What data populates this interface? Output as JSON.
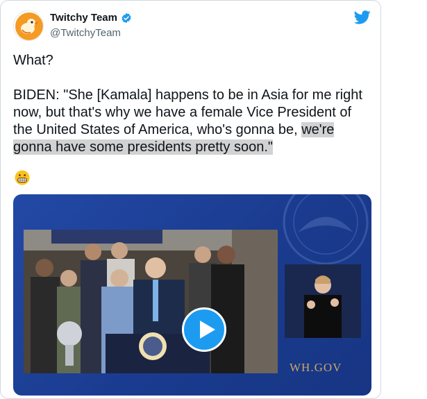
{
  "tweet": {
    "author_name": "Twitchy Team",
    "author_handle": "@TwitchyTeam",
    "text_line1": "What?",
    "text_quote_plain": "BIDEN: \"She [Kamala] happens to be in Asia for me right now, but that's why we have a female Vice President of the United States of America, who's gonna be, ",
    "text_quote_highlight": "we're gonna have some presidents pretty soon.\"",
    "emoji": "grimacing-face"
  },
  "media": {
    "watermark": "WH.GOV",
    "background_color": "#1f45a0",
    "play_button_color": "#1d9bf0"
  },
  "icons": {
    "avatar": "twitchy-bird-logo",
    "verified": "verified-badge-icon",
    "brand": "twitter-bird-icon",
    "play": "play-icon"
  },
  "colors": {
    "accent": "#1d9bf0",
    "handle": "#536471",
    "text": "#0f1419",
    "highlight": "#d2d2d2"
  }
}
